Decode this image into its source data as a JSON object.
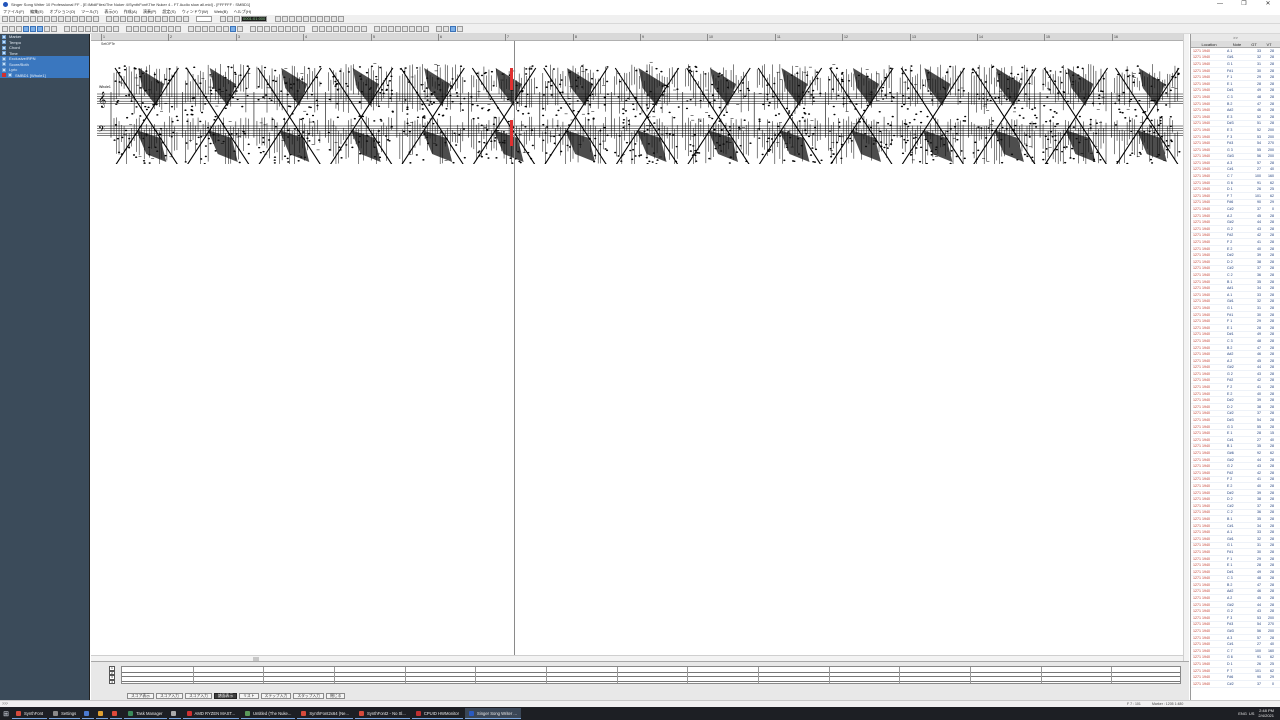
{
  "window": {
    "title": "Singer Song Writer 10 Professional FF - [E:\\MidiFiles\\The Nuker 4\\SynthFont\\The Nuker 4 - FT Audio slow all.mid] - [FFFFFF : SMBD1]",
    "controls": [
      "—",
      "❐",
      "✕"
    ]
  },
  "menu": [
    "ファイル(F)",
    "編集(E)",
    "オプション(O)",
    "ツール(T)",
    "表示(V)",
    "作成(A)",
    "演奏(P)",
    "設定(S)",
    "ウィンドウ(W)",
    "Web(B)",
    "ヘルプ(H)"
  ],
  "toolbar": {
    "position_display": "0001:01:000",
    "tempo_field": ""
  },
  "tracks": [
    {
      "name": "Marker",
      "selected": false
    },
    {
      "name": "Tempo",
      "selected": false
    },
    {
      "name": "Chord",
      "selected": false
    },
    {
      "name": "Time",
      "selected": false
    },
    {
      "name": "Exclusive/RPN",
      "selected": true
    },
    {
      "name": "Score/Both",
      "selected": true
    },
    {
      "name": "Lyric",
      "selected": true
    },
    {
      "name": "SMBD1 [Whole1]",
      "selected": true,
      "recording": true
    }
  ],
  "score": {
    "caption": "SetOPTe",
    "ruler_labels": [
      "1",
      "2",
      "3",
      "4",
      "5",
      "6",
      "7",
      "8",
      "9",
      "10",
      "11",
      "12",
      "13",
      "14",
      "15",
      "16"
    ],
    "clef_label": "Whole1"
  },
  "event_list": {
    "top_label": ">>",
    "columns": [
      "Location",
      "Note",
      "GT",
      "VT"
    ],
    "rows": [
      {
        "loc": "1271 1940",
        "note": "A 1",
        "gt": "33",
        "vel": "28"
      },
      {
        "loc": "1271 1940",
        "note": "G#1",
        "gt": "32",
        "vel": "28"
      },
      {
        "loc": "1271 1940",
        "note": "G 1",
        "gt": "31",
        "vel": "28"
      },
      {
        "loc": "1271 1940",
        "note": "F#1",
        "gt": "30",
        "vel": "28"
      },
      {
        "loc": "1271 1940",
        "note": "F 1",
        "gt": "29",
        "vel": "28"
      },
      {
        "loc": "1271 1940",
        "note": "E 1",
        "gt": "28",
        "vel": "28"
      },
      {
        "loc": "1271 1940",
        "note": "D#1",
        "gt": "49",
        "vel": "28"
      },
      {
        "loc": "1271 1940",
        "note": "C 3",
        "gt": "48",
        "vel": "28"
      },
      {
        "loc": "1271 1940",
        "note": "B 2",
        "gt": "47",
        "vel": "28"
      },
      {
        "loc": "1271 1940",
        "note": "A#2",
        "gt": "46",
        "vel": "28"
      },
      {
        "loc": "1271 1940",
        "note": "E 3",
        "gt": "52",
        "vel": "28"
      },
      {
        "loc": "1271 1940",
        "note": "D#3",
        "gt": "51",
        "vel": "28"
      },
      {
        "loc": "1271 1940",
        "note": "E 3",
        "gt": "52",
        "vel": "200"
      },
      {
        "loc": "1271 1940",
        "note": "F 3",
        "gt": "53",
        "vel": "200"
      },
      {
        "loc": "1271 1940",
        "note": "F#3",
        "gt": "54",
        "vel": "270"
      },
      {
        "loc": "1271 1940",
        "note": "G 3",
        "gt": "55",
        "vel": "200"
      },
      {
        "loc": "1271 1940",
        "note": "G#3",
        "gt": "56",
        "vel": "200"
      },
      {
        "loc": "1271 1940",
        "note": "A 3",
        "gt": "57",
        "vel": "28"
      },
      {
        "loc": "1271 1940",
        "note": "C#1",
        "gt": "27",
        "vel": "40"
      },
      {
        "loc": "1271 1940",
        "note": "C 7",
        "gt": "100",
        "vel": "160"
      },
      {
        "loc": "1271 1940",
        "note": "G 6",
        "gt": "91",
        "vel": "62"
      },
      {
        "loc": "1271 1940",
        "note": "D 1",
        "gt": "26",
        "vel": "25"
      },
      {
        "loc": "1271 1940",
        "note": "F 7",
        "gt": "101",
        "vel": "62"
      },
      {
        "loc": "1271 1940",
        "note": "F#6",
        "gt": "90",
        "vel": "29"
      },
      {
        "loc": "1271 1940",
        "note": "C#2",
        "gt": "37",
        "vel": "0"
      },
      {
        "loc": "1271 1940",
        "note": "A 2",
        "gt": "45",
        "vel": "28"
      },
      {
        "loc": "1271 1940",
        "note": "G#2",
        "gt": "44",
        "vel": "28"
      },
      {
        "loc": "1271 1940",
        "note": "G 2",
        "gt": "43",
        "vel": "28"
      },
      {
        "loc": "1271 1940",
        "note": "F#2",
        "gt": "42",
        "vel": "28"
      },
      {
        "loc": "1271 1940",
        "note": "F 2",
        "gt": "41",
        "vel": "28"
      },
      {
        "loc": "1271 1940",
        "note": "E 2",
        "gt": "40",
        "vel": "28"
      },
      {
        "loc": "1271 1940",
        "note": "D#2",
        "gt": "39",
        "vel": "28"
      },
      {
        "loc": "1271 1940",
        "note": "D 2",
        "gt": "38",
        "vel": "28"
      },
      {
        "loc": "1271 1940",
        "note": "C#2",
        "gt": "37",
        "vel": "28"
      },
      {
        "loc": "1271 1940",
        "note": "C 2",
        "gt": "36",
        "vel": "28"
      },
      {
        "loc": "1271 1940",
        "note": "B 1",
        "gt": "35",
        "vel": "28"
      },
      {
        "loc": "1271 1940",
        "note": "A#1",
        "gt": "34",
        "vel": "28"
      },
      {
        "loc": "1271 1940",
        "note": "A 1",
        "gt": "33",
        "vel": "28"
      },
      {
        "loc": "1271 1940",
        "note": "G#1",
        "gt": "32",
        "vel": "28"
      },
      {
        "loc": "1271 1940",
        "note": "G 1",
        "gt": "31",
        "vel": "28"
      },
      {
        "loc": "1271 1940",
        "note": "F#1",
        "gt": "30",
        "vel": "28"
      },
      {
        "loc": "1271 1940",
        "note": "F 1",
        "gt": "29",
        "vel": "28"
      },
      {
        "loc": "1271 1940",
        "note": "E 1",
        "gt": "28",
        "vel": "28"
      },
      {
        "loc": "1271 1940",
        "note": "D#1",
        "gt": "49",
        "vel": "28"
      },
      {
        "loc": "1271 1940",
        "note": "C 3",
        "gt": "48",
        "vel": "28"
      },
      {
        "loc": "1271 1940",
        "note": "B 2",
        "gt": "47",
        "vel": "28"
      },
      {
        "loc": "1271 1940",
        "note": "A#2",
        "gt": "46",
        "vel": "28"
      },
      {
        "loc": "1271 1940",
        "note": "A 2",
        "gt": "45",
        "vel": "28"
      },
      {
        "loc": "1271 1940",
        "note": "G#2",
        "gt": "44",
        "vel": "28"
      },
      {
        "loc": "1271 1940",
        "note": "G 2",
        "gt": "43",
        "vel": "28"
      },
      {
        "loc": "1271 1940",
        "note": "F#2",
        "gt": "42",
        "vel": "28"
      },
      {
        "loc": "1271 1940",
        "note": "F 2",
        "gt": "41",
        "vel": "28"
      },
      {
        "loc": "1271 1940",
        "note": "E 2",
        "gt": "40",
        "vel": "28"
      },
      {
        "loc": "1271 1940",
        "note": "D#2",
        "gt": "39",
        "vel": "28"
      },
      {
        "loc": "1271 1940",
        "note": "D 2",
        "gt": "38",
        "vel": "28"
      },
      {
        "loc": "1271 1940",
        "note": "C#2",
        "gt": "37",
        "vel": "28"
      },
      {
        "loc": "1271 1940",
        "note": "D#3",
        "gt": "54",
        "vel": "28"
      },
      {
        "loc": "1271 1940",
        "note": "G 3",
        "gt": "55",
        "vel": "28"
      },
      {
        "loc": "1271 1940",
        "note": "E 1",
        "gt": "28",
        "vel": "15"
      },
      {
        "loc": "1271 1940",
        "note": "C#1",
        "gt": "27",
        "vel": "40"
      },
      {
        "loc": "1271 1940",
        "note": "B 1",
        "gt": "35",
        "vel": "28"
      },
      {
        "loc": "1271 1940",
        "note": "G#6",
        "gt": "92",
        "vel": "62"
      },
      {
        "loc": "1271 1940",
        "note": "G#2",
        "gt": "44",
        "vel": "28"
      },
      {
        "loc": "1271 1940",
        "note": "G 2",
        "gt": "43",
        "vel": "28"
      },
      {
        "loc": "1271 1940",
        "note": "F#2",
        "gt": "42",
        "vel": "28"
      },
      {
        "loc": "1271 1940",
        "note": "F 2",
        "gt": "41",
        "vel": "28"
      },
      {
        "loc": "1271 1940",
        "note": "E 2",
        "gt": "40",
        "vel": "28"
      },
      {
        "loc": "1271 1940",
        "note": "D#2",
        "gt": "39",
        "vel": "28"
      },
      {
        "loc": "1271 1940",
        "note": "D 2",
        "gt": "38",
        "vel": "28"
      },
      {
        "loc": "1271 1940",
        "note": "C#2",
        "gt": "37",
        "vel": "28"
      },
      {
        "loc": "1271 1940",
        "note": "C 2",
        "gt": "36",
        "vel": "28"
      },
      {
        "loc": "1271 1940",
        "note": "B 1",
        "gt": "35",
        "vel": "28"
      },
      {
        "loc": "1271 1940",
        "note": "C#1",
        "gt": "34",
        "vel": "28"
      },
      {
        "loc": "1271 1940",
        "note": "A 1",
        "gt": "33",
        "vel": "28"
      },
      {
        "loc": "1271 1940",
        "note": "G#1",
        "gt": "32",
        "vel": "28"
      },
      {
        "loc": "1271 1940",
        "note": "G 1",
        "gt": "31",
        "vel": "28"
      },
      {
        "loc": "1271 1940",
        "note": "F#1",
        "gt": "30",
        "vel": "28"
      },
      {
        "loc": "1271 1940",
        "note": "F 1",
        "gt": "29",
        "vel": "28"
      },
      {
        "loc": "1271 1940",
        "note": "E 1",
        "gt": "28",
        "vel": "28"
      },
      {
        "loc": "1271 1940",
        "note": "D#1",
        "gt": "49",
        "vel": "28"
      },
      {
        "loc": "1271 1940",
        "note": "C 3",
        "gt": "48",
        "vel": "28"
      },
      {
        "loc": "1271 1940",
        "note": "B 2",
        "gt": "47",
        "vel": "28"
      },
      {
        "loc": "1271 1940",
        "note": "A#2",
        "gt": "46",
        "vel": "28"
      },
      {
        "loc": "1271 1940",
        "note": "A 2",
        "gt": "45",
        "vel": "28"
      },
      {
        "loc": "1271 1940",
        "note": "G#2",
        "gt": "44",
        "vel": "28"
      },
      {
        "loc": "1271 1940",
        "note": "G 2",
        "gt": "43",
        "vel": "28"
      },
      {
        "loc": "1271 1940",
        "note": "F 3",
        "gt": "53",
        "vel": "200"
      },
      {
        "loc": "1271 1940",
        "note": "F#3",
        "gt": "54",
        "vel": "270"
      },
      {
        "loc": "1271 1940",
        "note": "G#3",
        "gt": "56",
        "vel": "200"
      },
      {
        "loc": "1271 1940",
        "note": "A 3",
        "gt": "57",
        "vel": "28"
      },
      {
        "loc": "1271 1940",
        "note": "C#1",
        "gt": "27",
        "vel": "40"
      },
      {
        "loc": "1271 1940",
        "note": "C 7",
        "gt": "100",
        "vel": "160"
      },
      {
        "loc": "1271 1940",
        "note": "G 6",
        "gt": "91",
        "vel": "62"
      },
      {
        "loc": "1271 1940",
        "note": "D 1",
        "gt": "26",
        "vel": "25"
      },
      {
        "loc": "1271 1940",
        "note": "F 7",
        "gt": "101",
        "vel": "62"
      },
      {
        "loc": "1271 1940",
        "note": "F#6",
        "gt": "90",
        "vel": "29"
      },
      {
        "loc": "1271 1940",
        "note": "C#2",
        "gt": "37",
        "vel": "0"
      }
    ]
  },
  "view_tabs": [
    {
      "label": "スコア表示",
      "active": false
    },
    {
      "label": "スコア入力",
      "active": false
    },
    {
      "label": "スコア入力",
      "active": false
    },
    {
      "label": "譜面表示",
      "active": true
    },
    {
      "label": "リスト",
      "active": false
    },
    {
      "label": "ステップ入力",
      "active": false
    },
    {
      "label": "スタップ入力",
      "active": false
    },
    {
      "label": "閉じる",
      "active": false
    }
  ],
  "overview": {
    "lane_numbers": [
      "1",
      "2",
      "3",
      "4"
    ]
  },
  "status": {
    "left": "???",
    "mid": "F 7 : 101",
    "right": "Marker : 1205 1:480"
  },
  "taskbar": {
    "tasks": [
      {
        "label": "SynthFont",
        "color": "#d64a3b",
        "active": false
      },
      {
        "label": "Settings",
        "color": "#8a8a8a",
        "active": false
      },
      {
        "label": "",
        "color": "#4a7ad0",
        "active": false
      },
      {
        "label": "",
        "color": "#e0a030",
        "active": false
      },
      {
        "label": "",
        "color": "#e04a3a",
        "active": false
      },
      {
        "label": "Task Manager",
        "color": "#3a8a5a",
        "active": false
      },
      {
        "label": "",
        "color": "#aaaaaa",
        "active": false
      },
      {
        "label": "AMD RYZEN MAST...",
        "color": "#d03030",
        "active": false
      },
      {
        "label": "Untitled (The Nuke...",
        "color": "#5a9a5a",
        "active": false
      },
      {
        "label": "SynthFont2x64 (Ne...",
        "color": "#d64a3b",
        "active": false
      },
      {
        "label": "SynthFont2 - No Sl...",
        "color": "#d64a3b",
        "active": false
      },
      {
        "label": "CPUID HWMonitor",
        "color": "#c03030",
        "active": false
      },
      {
        "label": "Singer Song Writer ...",
        "color": "#2a5ac0",
        "active": true
      }
    ],
    "tray": {
      "lang": "ENG",
      "region": "US",
      "time": "2:48 PM",
      "date": "2/4/2021"
    }
  }
}
